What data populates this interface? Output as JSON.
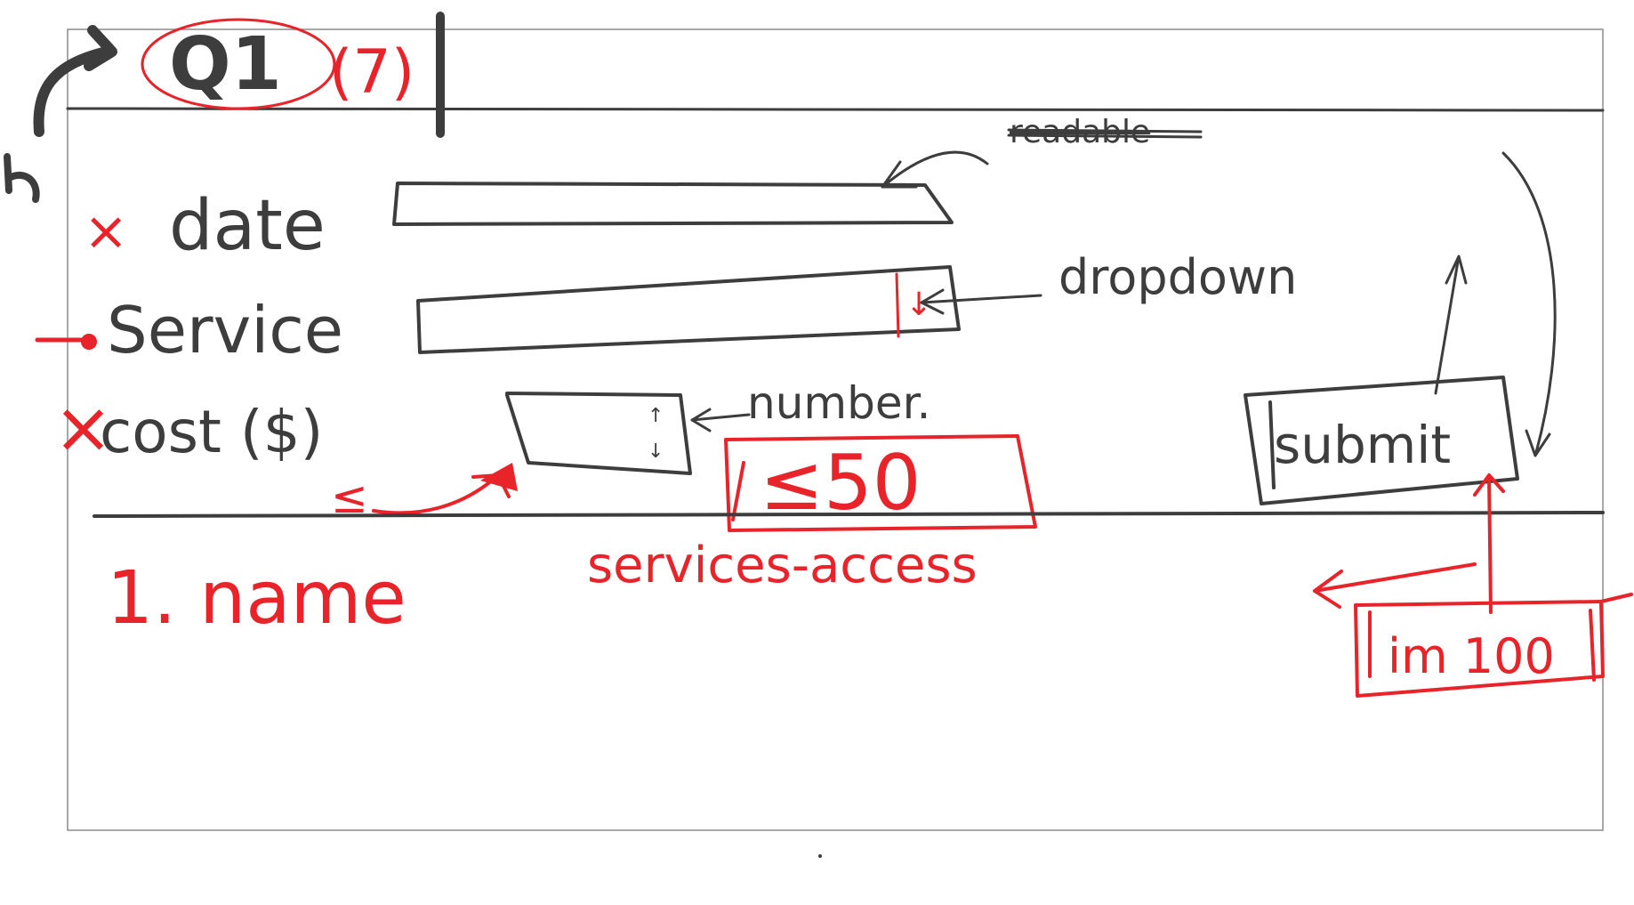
{
  "header": {
    "question_label": "Q1",
    "points": "(7)"
  },
  "form": {
    "date_label": "date",
    "service_label": "Service",
    "cost_label": "cost ($)",
    "submit_label": "submit"
  },
  "annotations": {
    "scratched_note": "readable",
    "dropdown_note": "dropdown",
    "number_note": "number.",
    "max_cost_note": "≤50",
    "min_symbol": "≤",
    "services_note": "services-access",
    "list_note": "1. name",
    "im_note": "im 100"
  },
  "colors": {
    "ink": "#3d3d3d",
    "annotation": "#e8242a",
    "frame": "#8c8c8c"
  }
}
